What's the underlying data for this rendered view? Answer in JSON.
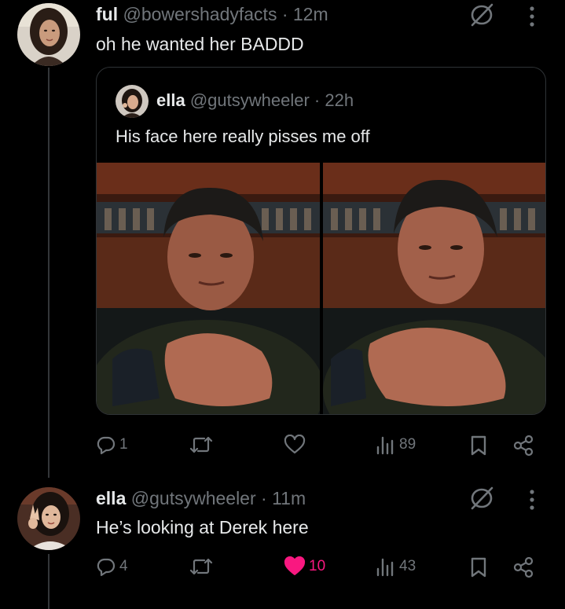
{
  "tweet1": {
    "name": "ful",
    "handle": "@bowershadyfacts",
    "time": "· 12m",
    "text": "oh he wanted her BADDD",
    "quote": {
      "name": "ella",
      "handle": "@gutsywheeler",
      "time": "· 22h",
      "text": "His face here really pisses me off"
    },
    "actions": {
      "replies": "1",
      "retweets": "",
      "likes": "",
      "views": "89"
    }
  },
  "tweet2": {
    "name": "ella",
    "handle": "@gutsywheeler",
    "time": "· 11m",
    "text": "He’s looking at Derek here",
    "actions": {
      "replies": "4",
      "retweets": "",
      "likes": "10",
      "views": "43"
    }
  },
  "colors": {
    "background": "#000000",
    "text_primary": "#e7e9ea",
    "text_secondary": "#71767b",
    "like_active": "#f91880",
    "border": "#2f3336"
  },
  "icons": [
    "mute-icon",
    "more-icon",
    "reply-icon",
    "retweet-icon",
    "like-icon",
    "views-icon",
    "bookmark-icon",
    "share-icon"
  ]
}
